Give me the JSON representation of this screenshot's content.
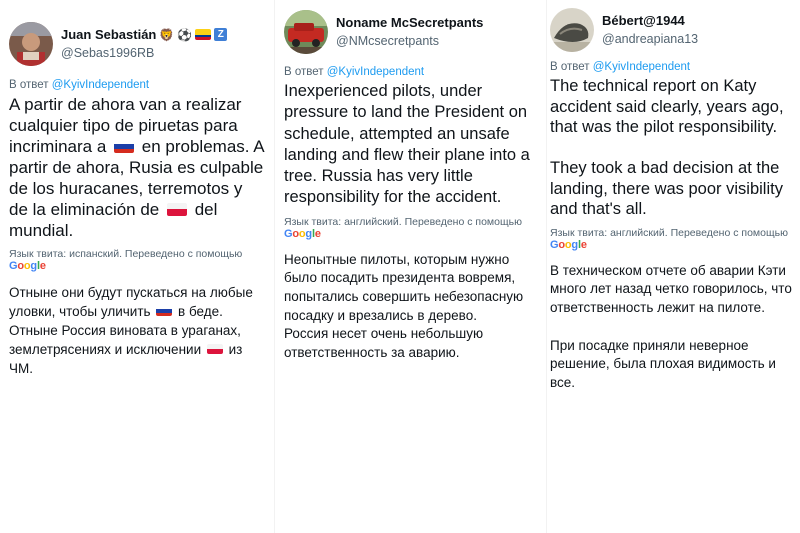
{
  "tweets": [
    {
      "name": "Juan Sebastián",
      "handle": "@Sebas1996RB",
      "reply_prefix": "В ответ",
      "reply_to": "@KyivIndependent",
      "text_a": "A partir de ahora van a realizar cualquier tipo de piruetas para incriminara a",
      "text_b": "en problemas. A partir de ahora, Rusia es culpable de los huracanes, terremotos y de la eliminación de",
      "text_c": "del mundial.",
      "lang_note": "Язык твита: испанский. Переведено с помощью",
      "translation_a": "Отныне они будут пускаться на любые уловки, чтобы уличить",
      "translation_b": "в беде.\nОтныне Россия виновата в ураганах, землетрясениях и исключении",
      "translation_c": "из ЧМ."
    },
    {
      "name": "Noname McSecretpants",
      "handle": "@NMcsecretpants",
      "reply_prefix": "В ответ",
      "reply_to": "@KyivIndependent",
      "text": "Inexperienced pilots, under pressure to land the President on schedule, attempted an unsafe landing and flew their plane into a tree. Russia has very little responsibility for the accident.",
      "lang_note": "Язык твита: английский. Переведено с помощью",
      "translation": "Неопытные пилоты, которым нужно было посадить президента вовремя, попытались совершить небезопасную посадку и врезались в дерево.\nРоссия несет очень небольшую ответственность за аварию."
    },
    {
      "name": "Bébert@1944",
      "handle": "@andreapiana13",
      "reply_prefix": "В ответ",
      "reply_to": "@KyivIndependent",
      "text": "The technical report on Katy accident said clearly, years ago, that was the pilot responsibility.\n\nThey took a bad decision at the landing, there was poor visibility and that's all.",
      "lang_note": "Язык твита: английский. Переведено с помощью",
      "translation": "В техническом отчете об аварии Кэти много лет назад четко говорилось, что ответственность лежит на пилоте.\n\nПри посадке приняли неверное решение, была плохая видимость и все."
    }
  ],
  "google_logo": {
    "G": "G",
    "o1": "o",
    "o2": "o",
    "g": "g",
    "l": "l",
    "e": "e"
  },
  "colors": {
    "link": "#1d9bf0",
    "secondary_text": "#536471",
    "primary_text": "#0f1419",
    "russia_flag": [
      "#ffffff",
      "#1c3fa8",
      "#d52b1e"
    ],
    "poland_flag": [
      "#ffffff",
      "#dc143c"
    ]
  },
  "icons": {
    "name_emojis_tweet1": [
      "lion-face-icon",
      "soccer-ball-icon",
      "colombia-flag-icon",
      "z-letter-icon"
    ],
    "inline_flags": [
      "russia-flag-icon",
      "poland-flag-icon"
    ]
  }
}
